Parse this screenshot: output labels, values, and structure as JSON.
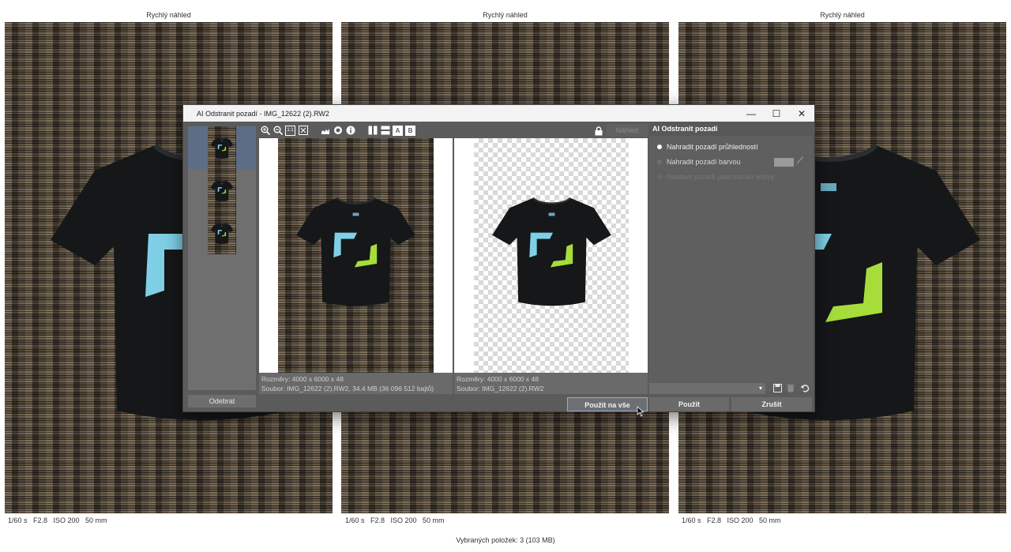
{
  "panes": [
    {
      "title": "Rychlý náhled",
      "meta": "1/60 s   F2.8   ISO 200   50 mm"
    },
    {
      "title": "Rychlý náhled",
      "meta": "1/60 s   F2.8   ISO 200   50 mm"
    },
    {
      "title": "Rychlý náhled",
      "meta": "1/60 s   F2.8   ISO 200   50 mm"
    }
  ],
  "status": "Vybraných položek: 3 (103 MB)",
  "dialog": {
    "title": "AI Odstranit pozadí - IMG_12622 (2).RW2",
    "window_buttons": {
      "minimize": "—",
      "maximize": "☐",
      "close": "✕"
    },
    "toolbar_icons": [
      "zoom-in-icon",
      "zoom-out-icon",
      "zoom-1to1-icon",
      "zoom-fit-icon",
      "histogram-icon",
      "mask-icon",
      "info-icon",
      "split-vertical-icon",
      "split-horizontal-icon",
      "view-a-icon",
      "view-b-icon"
    ],
    "toolbar_labels": {
      "a": "A",
      "b": "B",
      "one_to_one": "1:1"
    },
    "preview_button": "Náhled",
    "remove_button": "Odebrat",
    "left_info": {
      "dims": "Rozměry: 4000 x 6000 x 48",
      "file": "Soubor: IMG_12622 (2).RW2, 34.4 MB (36 096 512 bajtů)"
    },
    "right_info": {
      "dims": "Rozměry: 4000 x 6000 x 48",
      "file": "Soubor: IMG_12622 (2).RW2"
    },
    "side": {
      "header": "AI Odstranit pozadí",
      "options": [
        {
          "label": "Nahradit pozadí průhledností",
          "selected": true,
          "enabled": true
        },
        {
          "label": "Nahradit pozadí barvou",
          "selected": false,
          "enabled": true
        },
        {
          "label": "Nastavit pozadí jako masku vrstvy",
          "selected": false,
          "enabled": false
        }
      ],
      "preset_value": "",
      "bg_color": "#9a9a9a"
    },
    "buttons": {
      "apply_all": "Použít na vše",
      "apply": "Použít",
      "cancel": "Zrušit"
    }
  },
  "colors": {
    "tshirt": "#151719",
    "logo_blue": "#7fd0e6",
    "logo_green": "#a6dd3a",
    "accent_border": "#8fb0d8"
  }
}
